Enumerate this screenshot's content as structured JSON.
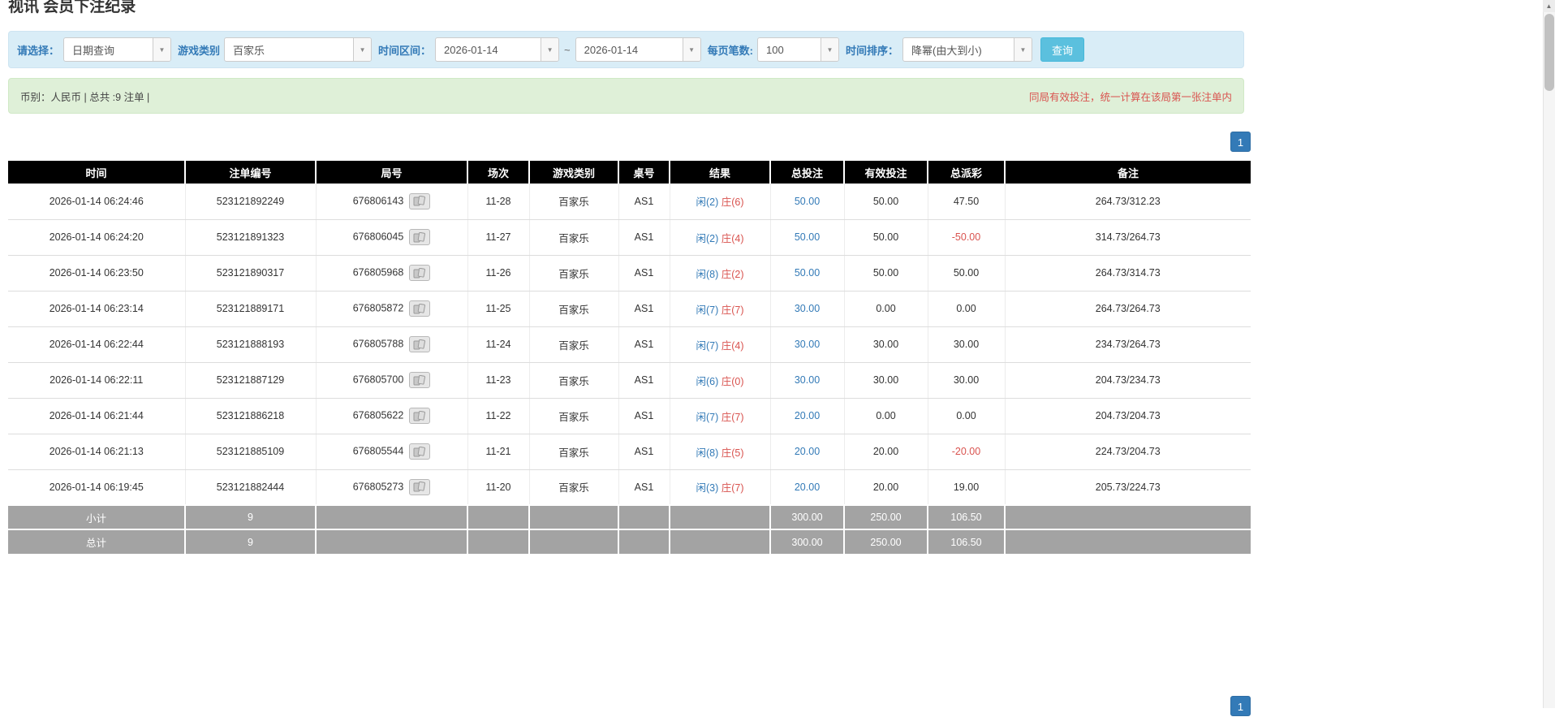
{
  "page": {
    "title": "视讯 会员下注纪录"
  },
  "colors": {
    "accent": "#337ab7",
    "search_button": "#5bc0de",
    "filter_bar_bg": "#d9edf7",
    "summary_bar_bg": "#dff0d8",
    "negative": "#d9534f",
    "player_blue": "#337ab7",
    "banker_red": "#d9534f",
    "header_bg": "#000000",
    "footer_bg": "#a3a3a3"
  },
  "filters": {
    "select_label": "请选择：",
    "query_type": "日期查询",
    "game_type_label": "游戏类别",
    "game_type": "百家乐",
    "time_range_label": "时间区间：",
    "time_from": "2026-01-14",
    "range_separator": "~",
    "time_to": "2026-01-14",
    "page_size_label": "每页笔数:",
    "page_size": "100",
    "sort_label": "时间排序：",
    "sort_value": "降幂(由大到小)",
    "search_label": "查询"
  },
  "summary": {
    "info": "币别：人民币 | 总共 :9 注单 |",
    "notice": "同局有效投注，统一计算在该局第一张注单内"
  },
  "pagination": {
    "current_page": "1"
  },
  "scrollbar": {
    "up_arrow": "▲"
  },
  "table": {
    "headers": [
      "时间",
      "注单编号",
      "局号",
      "场次",
      "游戏类别",
      "桌号",
      "结果",
      "总投注",
      "有效投注",
      "总派彩",
      "备注"
    ],
    "rows": [
      {
        "time": "2026-01-14 06:24:46",
        "bet_id": "523121892249",
        "round": "676806143",
        "session": "11-28",
        "game": "百家乐",
        "table_no": "AS1",
        "result_player": "闲(2)",
        "result_banker": "庄(6)",
        "total_bet": "50.00",
        "valid_bet": "50.00",
        "payout": "47.50",
        "note": "264.73/312.23"
      },
      {
        "time": "2026-01-14 06:24:20",
        "bet_id": "523121891323",
        "round": "676806045",
        "session": "11-27",
        "game": "百家乐",
        "table_no": "AS1",
        "result_player": "闲(2)",
        "result_banker": "庄(4)",
        "total_bet": "50.00",
        "valid_bet": "50.00",
        "payout": "-50.00",
        "note": "314.73/264.73"
      },
      {
        "time": "2026-01-14 06:23:50",
        "bet_id": "523121890317",
        "round": "676805968",
        "session": "11-26",
        "game": "百家乐",
        "table_no": "AS1",
        "result_player": "闲(8)",
        "result_banker": "庄(2)",
        "total_bet": "50.00",
        "valid_bet": "50.00",
        "payout": "50.00",
        "note": "264.73/314.73"
      },
      {
        "time": "2026-01-14 06:23:14",
        "bet_id": "523121889171",
        "round": "676805872",
        "session": "11-25",
        "game": "百家乐",
        "table_no": "AS1",
        "result_player": "闲(7)",
        "result_banker": "庄(7)",
        "total_bet": "30.00",
        "valid_bet": "0.00",
        "payout": "0.00",
        "note": "264.73/264.73"
      },
      {
        "time": "2026-01-14 06:22:44",
        "bet_id": "523121888193",
        "round": "676805788",
        "session": "11-24",
        "game": "百家乐",
        "table_no": "AS1",
        "result_player": "闲(7)",
        "result_banker": "庄(4)",
        "total_bet": "30.00",
        "valid_bet": "30.00",
        "payout": "30.00",
        "note": "234.73/264.73"
      },
      {
        "time": "2026-01-14 06:22:11",
        "bet_id": "523121887129",
        "round": "676805700",
        "session": "11-23",
        "game": "百家乐",
        "table_no": "AS1",
        "result_player": "闲(6)",
        "result_banker": "庄(0)",
        "total_bet": "30.00",
        "valid_bet": "30.00",
        "payout": "30.00",
        "note": "204.73/234.73"
      },
      {
        "time": "2026-01-14 06:21:44",
        "bet_id": "523121886218",
        "round": "676805622",
        "session": "11-22",
        "game": "百家乐",
        "table_no": "AS1",
        "result_player": "闲(7)",
        "result_banker": "庄(7)",
        "total_bet": "20.00",
        "valid_bet": "0.00",
        "payout": "0.00",
        "note": "204.73/204.73"
      },
      {
        "time": "2026-01-14 06:21:13",
        "bet_id": "523121885109",
        "round": "676805544",
        "session": "11-21",
        "game": "百家乐",
        "table_no": "AS1",
        "result_player": "闲(8)",
        "result_banker": "庄(5)",
        "total_bet": "20.00",
        "valid_bet": "20.00",
        "payout": "-20.00",
        "note": "224.73/204.73"
      },
      {
        "time": "2026-01-14 06:19:45",
        "bet_id": "523121882444",
        "round": "676805273",
        "session": "11-20",
        "game": "百家乐",
        "table_no": "AS1",
        "result_player": "闲(3)",
        "result_banker": "庄(7)",
        "total_bet": "20.00",
        "valid_bet": "20.00",
        "payout": "19.00",
        "note": "205.73/224.73"
      }
    ],
    "footer_rows": [
      {
        "label": "小计",
        "count": "9",
        "total_bet": "300.00",
        "valid_bet": "250.00",
        "payout": "106.50"
      },
      {
        "label": "总计",
        "count": "9",
        "total_bet": "300.00",
        "valid_bet": "250.00",
        "payout": "106.50"
      }
    ]
  }
}
